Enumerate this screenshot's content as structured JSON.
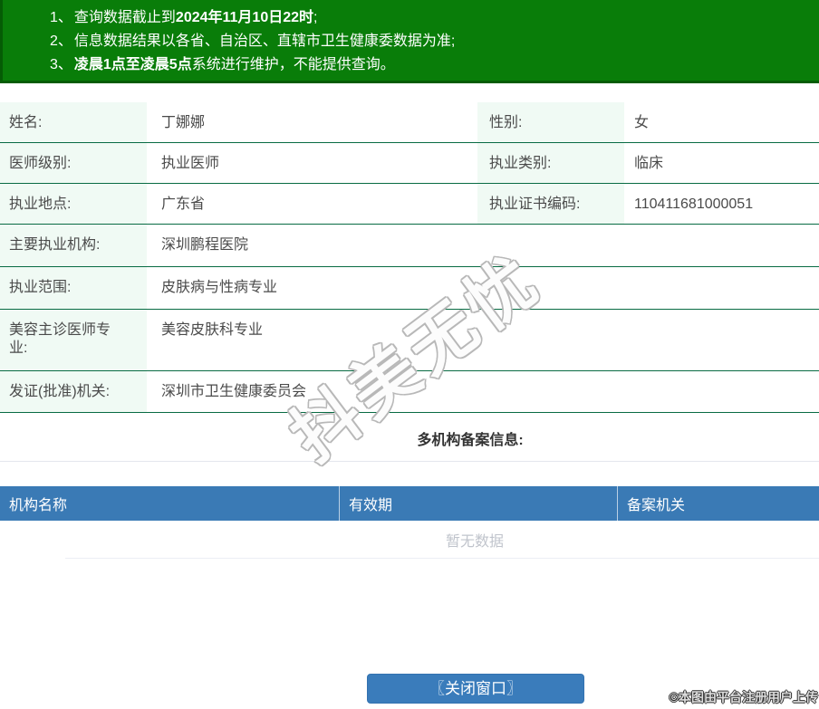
{
  "notice": {
    "line1": {
      "num": "1、",
      "pre": "查询数据截止到",
      "bold": "2024年11月10日22时",
      "post": ";"
    },
    "line2": {
      "num": "2、",
      "text": "信息数据结果以各省、自治区、直辖市卫生健康委数据为准;"
    },
    "line3": {
      "num": "3、",
      "bold": "凌晨1点至凌晨5点",
      "post": "系统进行维护，不能提供查询。"
    }
  },
  "info": {
    "rows": [
      {
        "label": "姓名:",
        "value": "丁娜娜",
        "label2": "性别:",
        "value2": "女"
      },
      {
        "label": "医师级别:",
        "value": "执业医师",
        "label2": "执业类别:",
        "value2": "临床"
      },
      {
        "label": "执业地点:",
        "value": "广东省",
        "label2": "执业证书编码:",
        "value2": "110411681000051"
      },
      {
        "label": "主要执业机构:",
        "value": "深圳鹏程医院"
      },
      {
        "label": "执业范围:",
        "value": "皮肤病与性病专业"
      },
      {
        "label": "美容主诊医师专业:",
        "value": "美容皮肤科专业"
      },
      {
        "label": "发证(批准)机关:",
        "value": "深圳市卫生健康委员会"
      }
    ]
  },
  "multi_org": {
    "heading": "多机构备案信息:",
    "columns": [
      "机构名称",
      "有效期",
      "备案机关"
    ],
    "empty_text": "暂无数据"
  },
  "close_button": {
    "label": "〖关闭窗口〗"
  },
  "watermark": {
    "text": "抖美无忧"
  },
  "stamp": {
    "text": "©本图由平台注册用户上传"
  },
  "colors": {
    "banner_green": "#097d09",
    "banner_border_green": "#055c05",
    "row_border_green": "#086b43",
    "label_bg_mint": "#f0faf4",
    "header_blue": "#3a7ab5",
    "button_blue": "#3a7cbb",
    "empty_text_gray": "#c0c4cc"
  }
}
